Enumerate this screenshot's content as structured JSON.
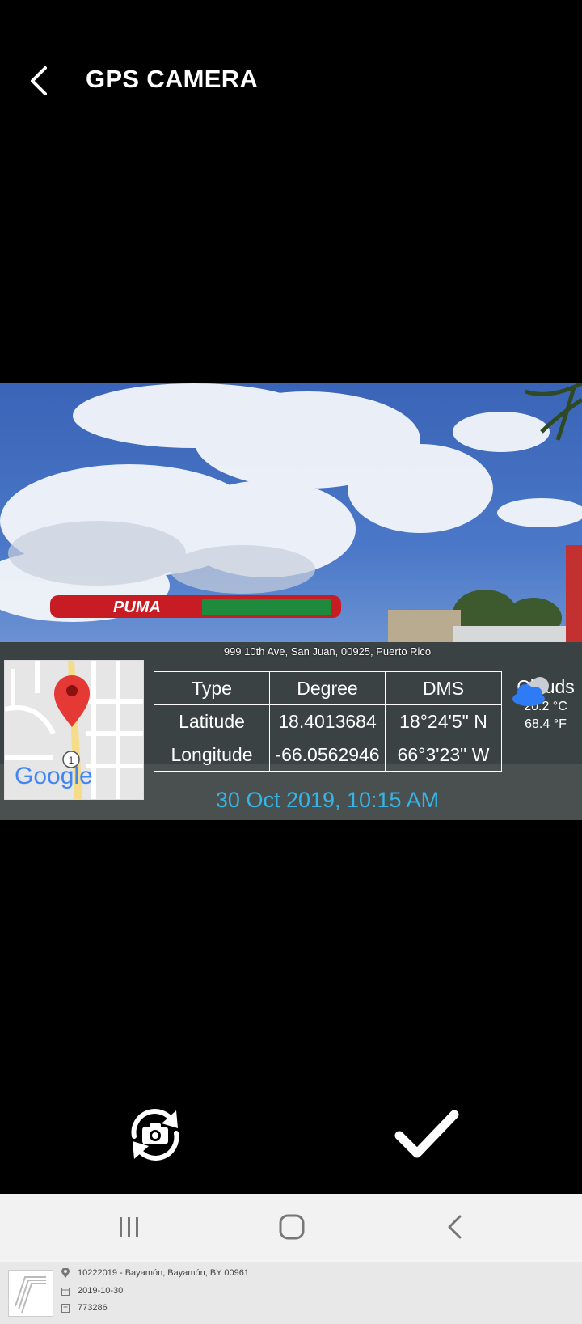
{
  "header": {
    "title": "GPS CAMERA"
  },
  "overlay": {
    "address": "999 10th Ave, San Juan, 00925, Puerto Rico",
    "map_logo": "Google",
    "map_badge": "1",
    "table": {
      "headers": [
        "Type",
        "Degree",
        "DMS"
      ],
      "rows": [
        [
          "Latitude",
          "18.4013684",
          "18°24'5\" N"
        ],
        [
          "Longitude",
          "-66.0562946",
          "66°3'23\" W"
        ]
      ]
    },
    "weather": {
      "condition": "Clouds",
      "temp_c": "20.2 °C",
      "temp_f": "68.4 °F",
      "icon": "cloud-icon"
    },
    "datetime": "30 Oct 2019, 10:15 AM",
    "station_sign": "PUMA"
  },
  "controls": {
    "switch_icon": "camera-switch-icon",
    "confirm_icon": "checkmark-icon"
  },
  "navbar": {
    "icons": [
      "recents-icon",
      "home-icon",
      "back-icon"
    ]
  },
  "footer": {
    "location": "10222019 - Bayamón, Bayamón, BY 00961",
    "date": "2019-10-30",
    "id": "773286"
  },
  "colors": {
    "accent": "#33b5e5",
    "pin": "#e53935",
    "cloud": "#2d7cf6"
  }
}
